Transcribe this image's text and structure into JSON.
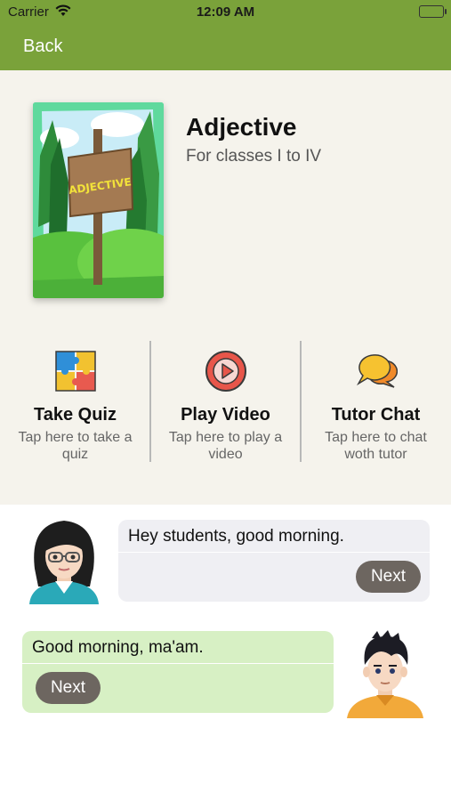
{
  "status_bar": {
    "carrier": "Carrier",
    "time": "12:09 AM"
  },
  "nav": {
    "back_label": "Back"
  },
  "course": {
    "title": "Adjective",
    "subtitle": "For classes I to IV",
    "cover_sign_text": "ADJECTIVE"
  },
  "actions": [
    {
      "icon": "puzzle-icon",
      "title": "Take Quiz",
      "description": "Tap here to take a quiz"
    },
    {
      "icon": "play-icon",
      "title": "Play Video",
      "description": "Tap here to play a video"
    },
    {
      "icon": "chat-bubbles-icon",
      "title": "Tutor Chat",
      "description": "Tap here to chat woth tutor"
    }
  ],
  "chat": {
    "teacher_message": "Hey students, good morning.",
    "student_message": "Good morning, ma'am.",
    "next_label": "Next"
  },
  "colors": {
    "accent": "#7aa23a",
    "background": "#f5f3ec",
    "student_bubble": "#d7f0c4",
    "teacher_bubble": "#efeff3",
    "next_button": "#6d6660"
  }
}
